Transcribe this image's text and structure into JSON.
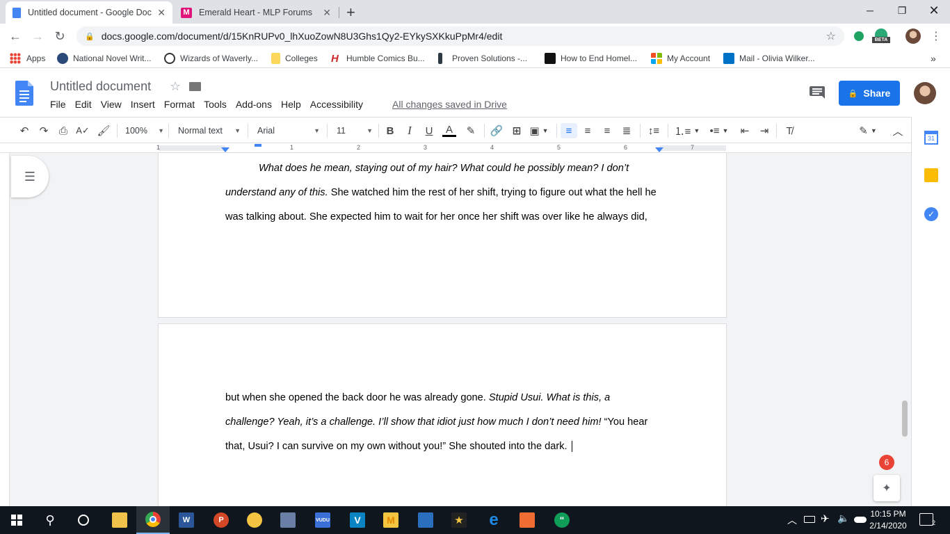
{
  "browser": {
    "tabs": [
      {
        "title": "Untitled document - Google Doc",
        "active": true
      },
      {
        "title": "Emerald Heart - MLP Forums",
        "active": false
      }
    ],
    "new_tab_icon": "plus-icon",
    "url": "docs.google.com/document/d/15KnRUPv0_lhXuoZowN8U3Ghs1Qy2-EYkySXKkuPpMr4/edit",
    "ext_badge": "BETA",
    "bookmarks": [
      {
        "label": "Apps",
        "color": "#ea4335"
      },
      {
        "label": "National Novel Writ...",
        "color": "#2b4a7a"
      },
      {
        "label": "Wizards of Waverly...",
        "color": "#333333"
      },
      {
        "label": "Colleges",
        "color": "#fbd75b"
      },
      {
        "label": "Humble Comics Bu...",
        "color": "#cc2929"
      },
      {
        "label": "Proven Solutions -...",
        "color": "#2d3a44"
      },
      {
        "label": "How to End Homel...",
        "color": "#111111"
      },
      {
        "label": "My Account",
        "color": "#f25022"
      },
      {
        "label": "Mail - Olivia Wilker...",
        "color": "#0072c6"
      }
    ],
    "bookmarks_overflow": "»"
  },
  "docs": {
    "title": "Untitled document",
    "menu": [
      "File",
      "Edit",
      "View",
      "Insert",
      "Format",
      "Tools",
      "Add-ons",
      "Help",
      "Accessibility"
    ],
    "save_status": "All changes saved in Drive",
    "share_label": "Share",
    "accent": "#1a73e8"
  },
  "toolbar": {
    "zoom": "100%",
    "style": "Normal text",
    "font": "Arial",
    "size": "11",
    "bold": "B",
    "italic": "I",
    "underline": "U",
    "text_color": "A"
  },
  "ruler": {
    "labels": [
      "1",
      "1",
      "2",
      "3",
      "4",
      "5",
      "6",
      "7"
    ]
  },
  "page1": {
    "line1_italic": "What does he mean, staying out of my hair? What could he possibly mean? I don’t",
    "line2_italic": "understand any of this.",
    "line2_plain": " She watched him the rest of her shift, trying to figure out what the hell he",
    "line3": "was talking about. She expected him to wait for her once her shift was over like he always did,"
  },
  "page2": {
    "line1_plain": "but when she opened the back door he was already gone. ",
    "line1_italic": "Stupid Usui. What is this, a",
    "line2_italic": "challenge? Yeah, it’s a challenge. I’ll show that idiot just how much I don’t need him!",
    "line2_plain": " “You hear",
    "line3": "that, Usui? I can survive on my own without you!” She shouted into the dark."
  },
  "notifications": "6",
  "taskbar": {
    "time": "10:15 PM",
    "date": "2/14/2020",
    "notif_count": "2",
    "apps": [
      {
        "name": "file-explorer",
        "label": "",
        "color": "#f0c24b"
      },
      {
        "name": "chrome",
        "label": "",
        "color": "#4285f4"
      },
      {
        "name": "word",
        "label": "W",
        "color": "#2b579a"
      },
      {
        "name": "powerpoint",
        "label": "P",
        "color": "#d24726"
      },
      {
        "name": "alarms",
        "label": "",
        "color": "#f4c542"
      },
      {
        "name": "tool",
        "label": "",
        "color": "#6a7fa8"
      },
      {
        "name": "vudu",
        "label": "VUDU",
        "color": "#3a6fd8"
      },
      {
        "name": "v-app",
        "label": "V",
        "color": "#0a84c2"
      },
      {
        "name": "m-app",
        "label": "M",
        "color": "#f5c542"
      },
      {
        "name": "news",
        "label": "",
        "color": "#2a6fbd"
      },
      {
        "name": "movies",
        "label": "★",
        "color": "#222222"
      },
      {
        "name": "edge",
        "label": "e",
        "color": "#1e88e5"
      },
      {
        "name": "people",
        "label": "",
        "color": "#ef6c32"
      },
      {
        "name": "hangouts",
        "label": "\"",
        "color": "#0f9d58"
      }
    ]
  }
}
